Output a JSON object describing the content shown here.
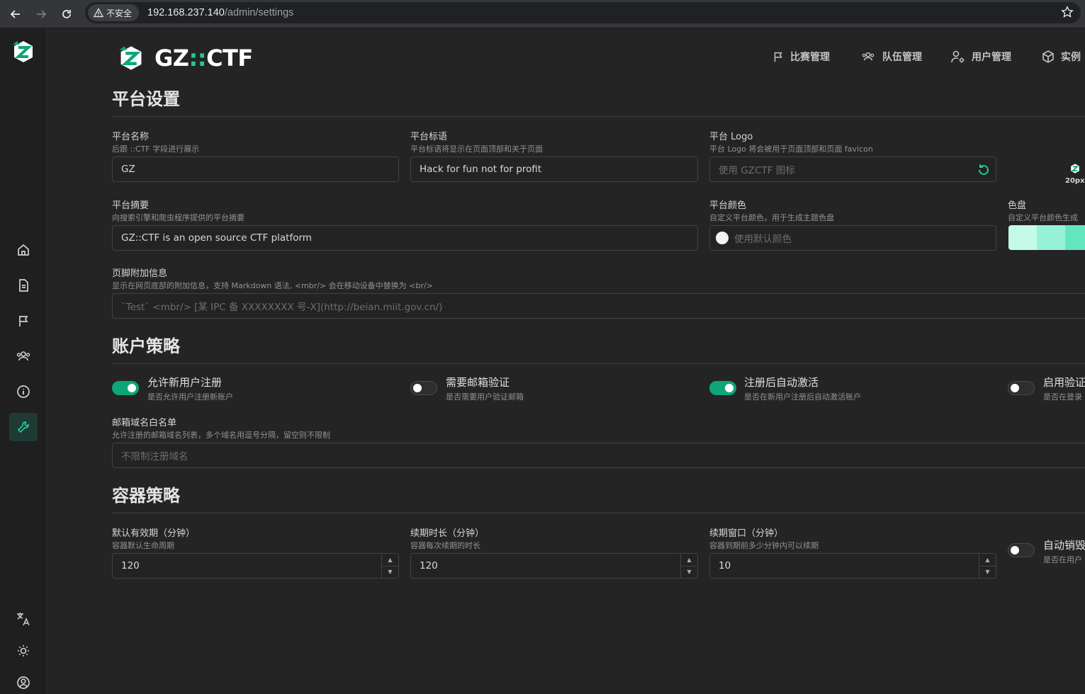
{
  "browser": {
    "security_label": "不安全",
    "url_host": "192.168.237.140",
    "url_path": "/admin/settings"
  },
  "brand": {
    "name_prefix": "GZ",
    "name_colons": "::",
    "name_suffix": "CTF"
  },
  "topnav": [
    {
      "label": "比赛管理",
      "icon": "flag-icon"
    },
    {
      "label": "队伍管理",
      "icon": "users-icon"
    },
    {
      "label": "用户管理",
      "icon": "user-cog-icon"
    },
    {
      "label": "实例",
      "icon": "box-icon"
    }
  ],
  "sections": {
    "platform": "平台设置",
    "account": "账户策略",
    "container": "容器策略"
  },
  "platform": {
    "name": {
      "label": "平台名称",
      "desc": "后跟 ::CTF 字段进行展示",
      "value": "GZ"
    },
    "slogan": {
      "label": "平台标语",
      "desc": "平台标语将显示在页面顶部和关于页面",
      "value": "Hack for fun not for profit"
    },
    "logo": {
      "label": "平台 Logo",
      "desc": "平台 Logo 将会被用于页面顶部和页面 favicon",
      "placeholder": "使用 GZCTF 图标",
      "size_label": "20px"
    },
    "summary": {
      "label": "平台摘要",
      "desc": "向搜索引擎和爬虫程序提供的平台摘要",
      "value": "GZ::CTF is an open source CTF platform"
    },
    "color": {
      "label": "平台颜色",
      "desc": "自定义平台颜色，用于生成主题色盘",
      "placeholder": "使用默认颜色"
    },
    "palette": {
      "label": "色盘",
      "desc": "自定义平台颜色生成",
      "colors": [
        "#c3fae8",
        "#96f2d7",
        "#63e6be"
      ]
    },
    "footer": {
      "label": "页脚附加信息",
      "desc": "显示在网页底部的附加信息，支持 Markdown 语法, <mbr/> 会在移动设备中替换为 <br/>",
      "placeholder": "`Test` <mbr/> [某 IPC 备 XXXXXXXX 号-X](http://beian.miit.gov.cn/)"
    }
  },
  "account": {
    "toggles": [
      {
        "title": "允许新用户注册",
        "desc": "是否允许用户注册新账户",
        "on": true
      },
      {
        "title": "需要邮箱验证",
        "desc": "是否需要用户验证邮箱",
        "on": false
      },
      {
        "title": "注册后自动激活",
        "desc": "是否在新用户注册后自动激活账户",
        "on": true
      },
      {
        "title": "启用验证",
        "desc": "是否在登录",
        "on": false
      }
    ],
    "whitelist": {
      "label": "邮箱域名白名单",
      "desc": "允许注册的邮箱域名列表，多个域名用逗号分隔，留空则不限制",
      "placeholder": "不限制注册域名"
    }
  },
  "container": {
    "default_lifetime": {
      "label": "默认有效期（分钟）",
      "desc": "容器默认生命周期",
      "value": "120"
    },
    "extension": {
      "label": "续期时长（分钟）",
      "desc": "容器每次续期的时长",
      "value": "120"
    },
    "renewal_window": {
      "label": "续期窗口（分钟）",
      "desc": "容器到期前多少分钟内可以续期",
      "value": "10"
    },
    "auto_destroy": {
      "title": "自动销毁",
      "desc": "是否在用户",
      "on": false
    }
  }
}
